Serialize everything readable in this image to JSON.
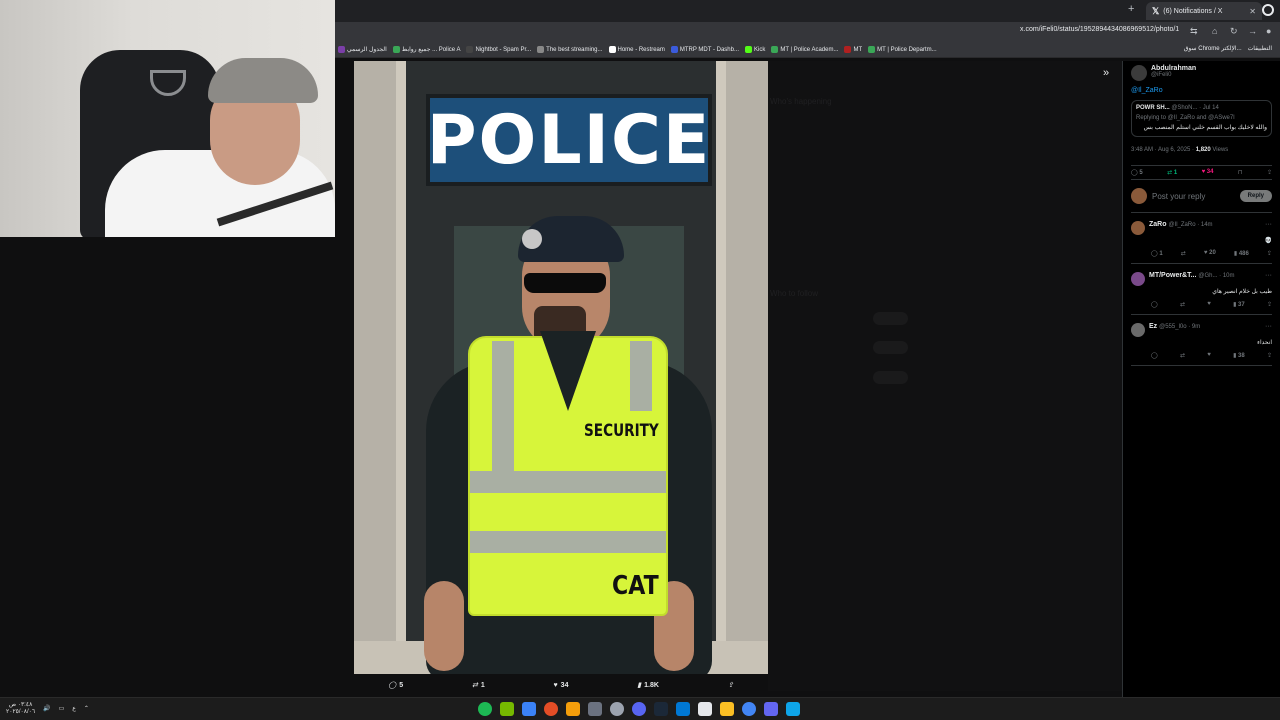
{
  "browser": {
    "tab_title": "(6) Notifications / X",
    "tab_close": "✕",
    "new_tab": "+",
    "url": "x.com/iFeli0/status/1952894434086969512/photo/1",
    "bookmarks": [
      {
        "label": "الجدول الرسمي",
        "color": "#7b3fa8"
      },
      {
        "label": "جميع روابط ... Police A",
        "color": "#3aa757"
      },
      {
        "label": "Nightbot - Spam Pr...",
        "color": "#444"
      },
      {
        "label": "The best streaming...",
        "color": "#888"
      },
      {
        "label": "Home - Restream",
        "color": "#fff"
      },
      {
        "label": "MTRP MDT - Dashb...",
        "color": "#3b5bdb"
      },
      {
        "label": "Kick",
        "color": "#53fc18"
      },
      {
        "label": "MT | Police Academ...",
        "color": "#3aa757"
      },
      {
        "label": "MT",
        "color": "#b02020"
      },
      {
        "label": "MT | Police Departm...",
        "color": "#3aa757"
      }
    ],
    "bookmarks_right": [
      "سوق Chrome الإلكتر...",
      "التطبيقات"
    ]
  },
  "media": {
    "sign_text": "POLICE",
    "vest_text_1": "SECURITY",
    "vest_text_2": "CAT",
    "actions": {
      "replies": "5",
      "reposts": "1",
      "likes": "34",
      "views": "1.8K"
    }
  },
  "background_ghost": {
    "heading_1": "Who's happening",
    "heading_2": "Who to follow"
  },
  "panel": {
    "author_name": "Abdulrahman",
    "author_handle": "@iFeli0",
    "mention": "@Il_ZaRo",
    "quote": {
      "name": "POWR SH...",
      "handle": "@ShoN...",
      "date": "· Jul 14",
      "reply_to": "Replying to @Il_ZaRo and @ASwe7l",
      "text": "والله لاخليك بواب القسم خلني استلم المنصب بس"
    },
    "meta_time": "3:48 AM · Aug 6, 2025 ·",
    "meta_views_num": "1,820",
    "meta_views_label": "Views",
    "stats": {
      "replies": "5",
      "reposts": "1",
      "likes": "34"
    },
    "compose_placeholder": "Post your reply",
    "reply_button": "Reply",
    "replies": [
      {
        "name": "ZaRo",
        "handle": "@Il_ZaRo · 14m",
        "text": "💀",
        "stats": [
          "1",
          "",
          "20",
          "486"
        ]
      },
      {
        "name": "MT/Power&T...",
        "handle": "@Gh... · 10m",
        "text": "طيب بل خلام انصير هاي",
        "stats": [
          "",
          "",
          "",
          "37"
        ]
      },
      {
        "name": "Ez",
        "handle": "@555_l0o · 9m",
        "text": "انحداء",
        "stats": [
          "",
          "",
          "",
          "38"
        ]
      }
    ]
  },
  "taskbar": {
    "clock_time": "٠٣:٤٨ ص",
    "clock_date": "٢٠٢٥/٠٨/٠٦",
    "lang": "ع"
  }
}
